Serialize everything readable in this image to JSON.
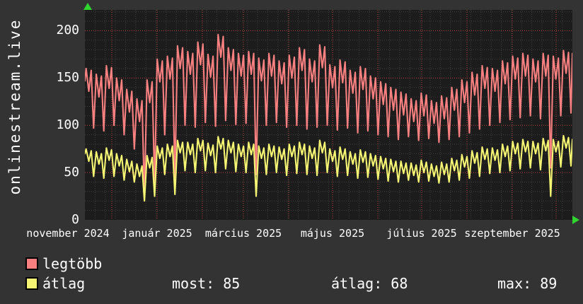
{
  "watermark": "onlinestream.live",
  "colors": {
    "background": "#333333",
    "plot_background": "#1c1c1c",
    "text": "#ffffff",
    "axis_arrow": "#2fd42f",
    "minor_grid": "#3f3f3f",
    "major_grid": "#b84343",
    "series_max": "#f88080",
    "series_avg": "#f5f573"
  },
  "legend": {
    "items": [
      {
        "label": "legtöbb",
        "color": "#f88080"
      },
      {
        "label": "átlag",
        "color": "#f5f573"
      }
    ]
  },
  "stats": {
    "items": [
      {
        "id": "most",
        "text": "most: 85"
      },
      {
        "id": "atlag",
        "text": "átlag: 68"
      },
      {
        "id": "max",
        "text": "max: 89"
      }
    ]
  },
  "chart_data": {
    "type": "line",
    "title": "",
    "xlabel": "",
    "ylabel": "",
    "ylim": [
      0,
      222
    ],
    "y_ticks": [
      200,
      150,
      100,
      50,
      0
    ],
    "x_tick_labels": [
      "november 2024",
      "január 2025",
      "március 2025",
      "május 2025",
      "július 2025",
      "szeptember 2025"
    ],
    "grid": "dotted; gray minor lines every 10 units / weekly, red major lines every 50 units / monthly",
    "legend_position": "bottom-left",
    "series": [
      {
        "name": "legtöbb",
        "color": "#f88080",
        "description": "weekly oscillation, values as [peak, trough] per week from mid-Nov 2024 to end of Sep 2025",
        "start": 147,
        "end": 176,
        "weekly_peak_trough": [
          [
            160,
            97
          ],
          [
            154,
            94
          ],
          [
            163,
            100
          ],
          [
            150,
            90
          ],
          [
            138,
            75
          ],
          [
            128,
            25
          ],
          [
            148,
            38
          ],
          [
            170,
            90
          ],
          [
            173,
            45
          ],
          [
            184,
            100
          ],
          [
            178,
            98
          ],
          [
            188,
            103
          ],
          [
            175,
            99
          ],
          [
            196,
            105
          ],
          [
            182,
            101
          ],
          [
            176,
            102
          ],
          [
            178,
            48
          ],
          [
            171,
            100
          ],
          [
            176,
            103
          ],
          [
            168,
            98
          ],
          [
            174,
            100
          ],
          [
            182,
            96
          ],
          [
            170,
            98
          ],
          [
            185,
            100
          ],
          [
            164,
            95
          ],
          [
            169,
            97
          ],
          [
            158,
            92
          ],
          [
            162,
            94
          ],
          [
            152,
            90
          ],
          [
            146,
            88
          ],
          [
            140,
            85
          ],
          [
            135,
            88
          ],
          [
            128,
            84
          ],
          [
            134,
            86
          ],
          [
            126,
            82
          ],
          [
            131,
            85
          ],
          [
            140,
            88
          ],
          [
            148,
            92
          ],
          [
            156,
            96
          ],
          [
            163,
            100
          ],
          [
            160,
            103
          ],
          [
            168,
            106
          ],
          [
            173,
            108
          ],
          [
            176,
            110
          ],
          [
            170,
            107
          ],
          [
            176,
            55
          ],
          [
            173,
            110
          ],
          [
            179,
            113
          ]
        ]
      },
      {
        "name": "átlag",
        "color": "#f5f573",
        "description": "weekly oscillation, values as [peak, trough] per week from mid-Nov 2024 to end of Sep 2025",
        "start": 70,
        "end": 85,
        "weekly_peak_trough": [
          [
            75,
            46
          ],
          [
            72,
            44
          ],
          [
            76,
            46
          ],
          [
            70,
            42
          ],
          [
            64,
            40
          ],
          [
            59,
            20
          ],
          [
            68,
            25
          ],
          [
            78,
            48
          ],
          [
            80,
            27
          ],
          [
            84,
            52
          ],
          [
            82,
            50
          ],
          [
            86,
            52
          ],
          [
            81,
            50
          ],
          [
            88,
            54
          ],
          [
            84,
            51
          ],
          [
            80,
            50
          ],
          [
            82,
            25
          ],
          [
            78,
            48
          ],
          [
            80,
            50
          ],
          [
            77,
            47
          ],
          [
            80,
            49
          ],
          [
            82,
            48
          ],
          [
            78,
            47
          ],
          [
            84,
            50
          ],
          [
            75,
            46
          ],
          [
            77,
            47
          ],
          [
            72,
            44
          ],
          [
            74,
            45
          ],
          [
            70,
            43
          ],
          [
            67,
            41
          ],
          [
            64,
            40
          ],
          [
            62,
            42
          ],
          [
            60,
            40
          ],
          [
            63,
            41
          ],
          [
            59,
            39
          ],
          [
            61,
            40
          ],
          [
            65,
            42
          ],
          [
            69,
            44
          ],
          [
            73,
            46
          ],
          [
            77,
            49
          ],
          [
            76,
            50
          ],
          [
            80,
            52
          ],
          [
            83,
            54
          ],
          [
            85,
            55
          ],
          [
            83,
            53
          ],
          [
            86,
            25
          ],
          [
            85,
            56
          ],
          [
            89,
            57
          ]
        ]
      }
    ]
  }
}
